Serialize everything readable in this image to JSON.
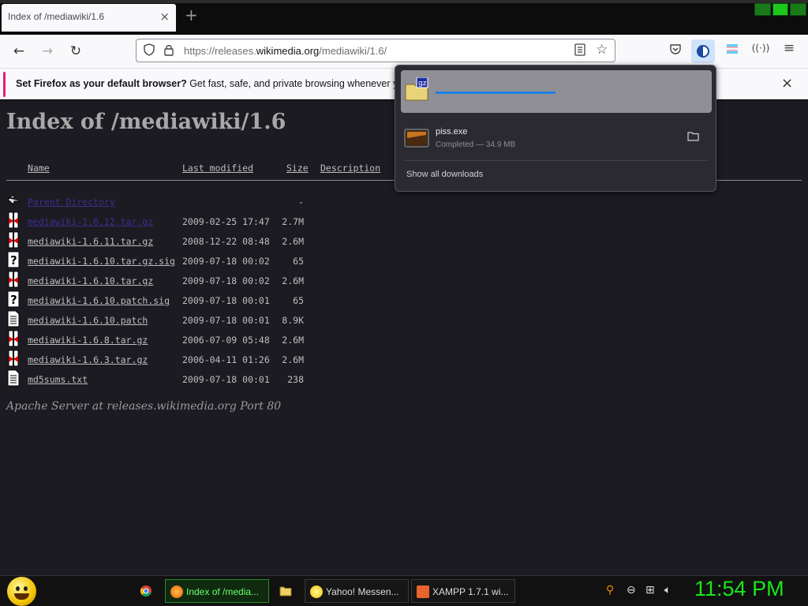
{
  "browser": {
    "tab_title": "Index of /mediawiki/1.6",
    "tab_close": "×",
    "new_tab": "+",
    "url_prefix": "https://releases.",
    "url_domain": "wikimedia.org",
    "url_path": "/mediawiki/1.6/",
    "icons": {
      "back": "arrow-left-icon",
      "forward": "arrow-right-icon",
      "reload": "reload-icon",
      "shield": "shield-icon",
      "lock": "lock-icon",
      "reader": "reader-view-icon",
      "bookmark": "star-icon",
      "pocket": "pocket-icon",
      "contrast": "contrast-icon",
      "flag": "trans-flag-icon",
      "extension": "extension-icon",
      "menu": "hamburger-menu-icon"
    }
  },
  "notification": {
    "bold": "Set Firefox as your default browser?",
    "text": " Get fast, safe, and private browsing whenever you us",
    "close": "×"
  },
  "page": {
    "title": "Index of /mediawiki/1.6",
    "headers": {
      "name": "Name",
      "modified": "Last modified",
      "size": "Size",
      "description": "Description"
    },
    "rows": [
      {
        "name": "Parent Directory",
        "date": "",
        "size": "-",
        "icon": "back-folder-icon"
      },
      {
        "name": "mediawiki-1.6.12.tar.gz",
        "date": "2009-02-25 17:47",
        "size": "2.7M",
        "icon": "archive-icon"
      },
      {
        "name": "mediawiki-1.6.11.tar.gz",
        "date": "2008-12-22 08:48",
        "size": "2.6M",
        "icon": "archive-icon"
      },
      {
        "name": "mediawiki-1.6.10.tar.gz.sig",
        "date": "2009-07-18 00:02",
        "size": "65",
        "icon": "unknown-file-icon"
      },
      {
        "name": "mediawiki-1.6.10.tar.gz",
        "date": "2009-07-18 00:02",
        "size": "2.6M",
        "icon": "archive-icon"
      },
      {
        "name": "mediawiki-1.6.10.patch.sig",
        "date": "2009-07-18 00:01",
        "size": "65",
        "icon": "unknown-file-icon"
      },
      {
        "name": "mediawiki-1.6.10.patch",
        "date": "2009-07-18 00:01",
        "size": "8.9K",
        "icon": "text-file-icon"
      },
      {
        "name": "mediawiki-1.6.8.tar.gz",
        "date": "2006-07-09 05:48",
        "size": "2.6M",
        "icon": "archive-icon"
      },
      {
        "name": "mediawiki-1.6.3.tar.gz",
        "date": "2006-04-11 01:26",
        "size": "2.6M",
        "icon": "archive-icon"
      },
      {
        "name": "md5sums.txt",
        "date": "2009-07-18 00:01",
        "size": "238",
        "icon": "text-file-icon"
      }
    ],
    "address": "Apache Server at releases.wikimedia.org Port 80"
  },
  "downloads": {
    "active": {
      "icon_label": "gz",
      "progress": 0.4
    },
    "completed": {
      "filename": "piss.exe",
      "status": "Completed — 34.9 MB"
    },
    "show_all": "Show all downloads"
  },
  "taskbar": {
    "items": [
      {
        "label": "Index of /media...",
        "active": true
      },
      {
        "label": "Yahoo! Messen...",
        "active": false
      },
      {
        "label": "XAMPP 1.7.1 wi...",
        "active": false
      }
    ],
    "clock": "11:54 PM"
  },
  "colors": {
    "page_bg": "#1c1b22",
    "progress": "#1f7fe0",
    "clock": "#17e817",
    "notification_accent": "#e0207a"
  }
}
